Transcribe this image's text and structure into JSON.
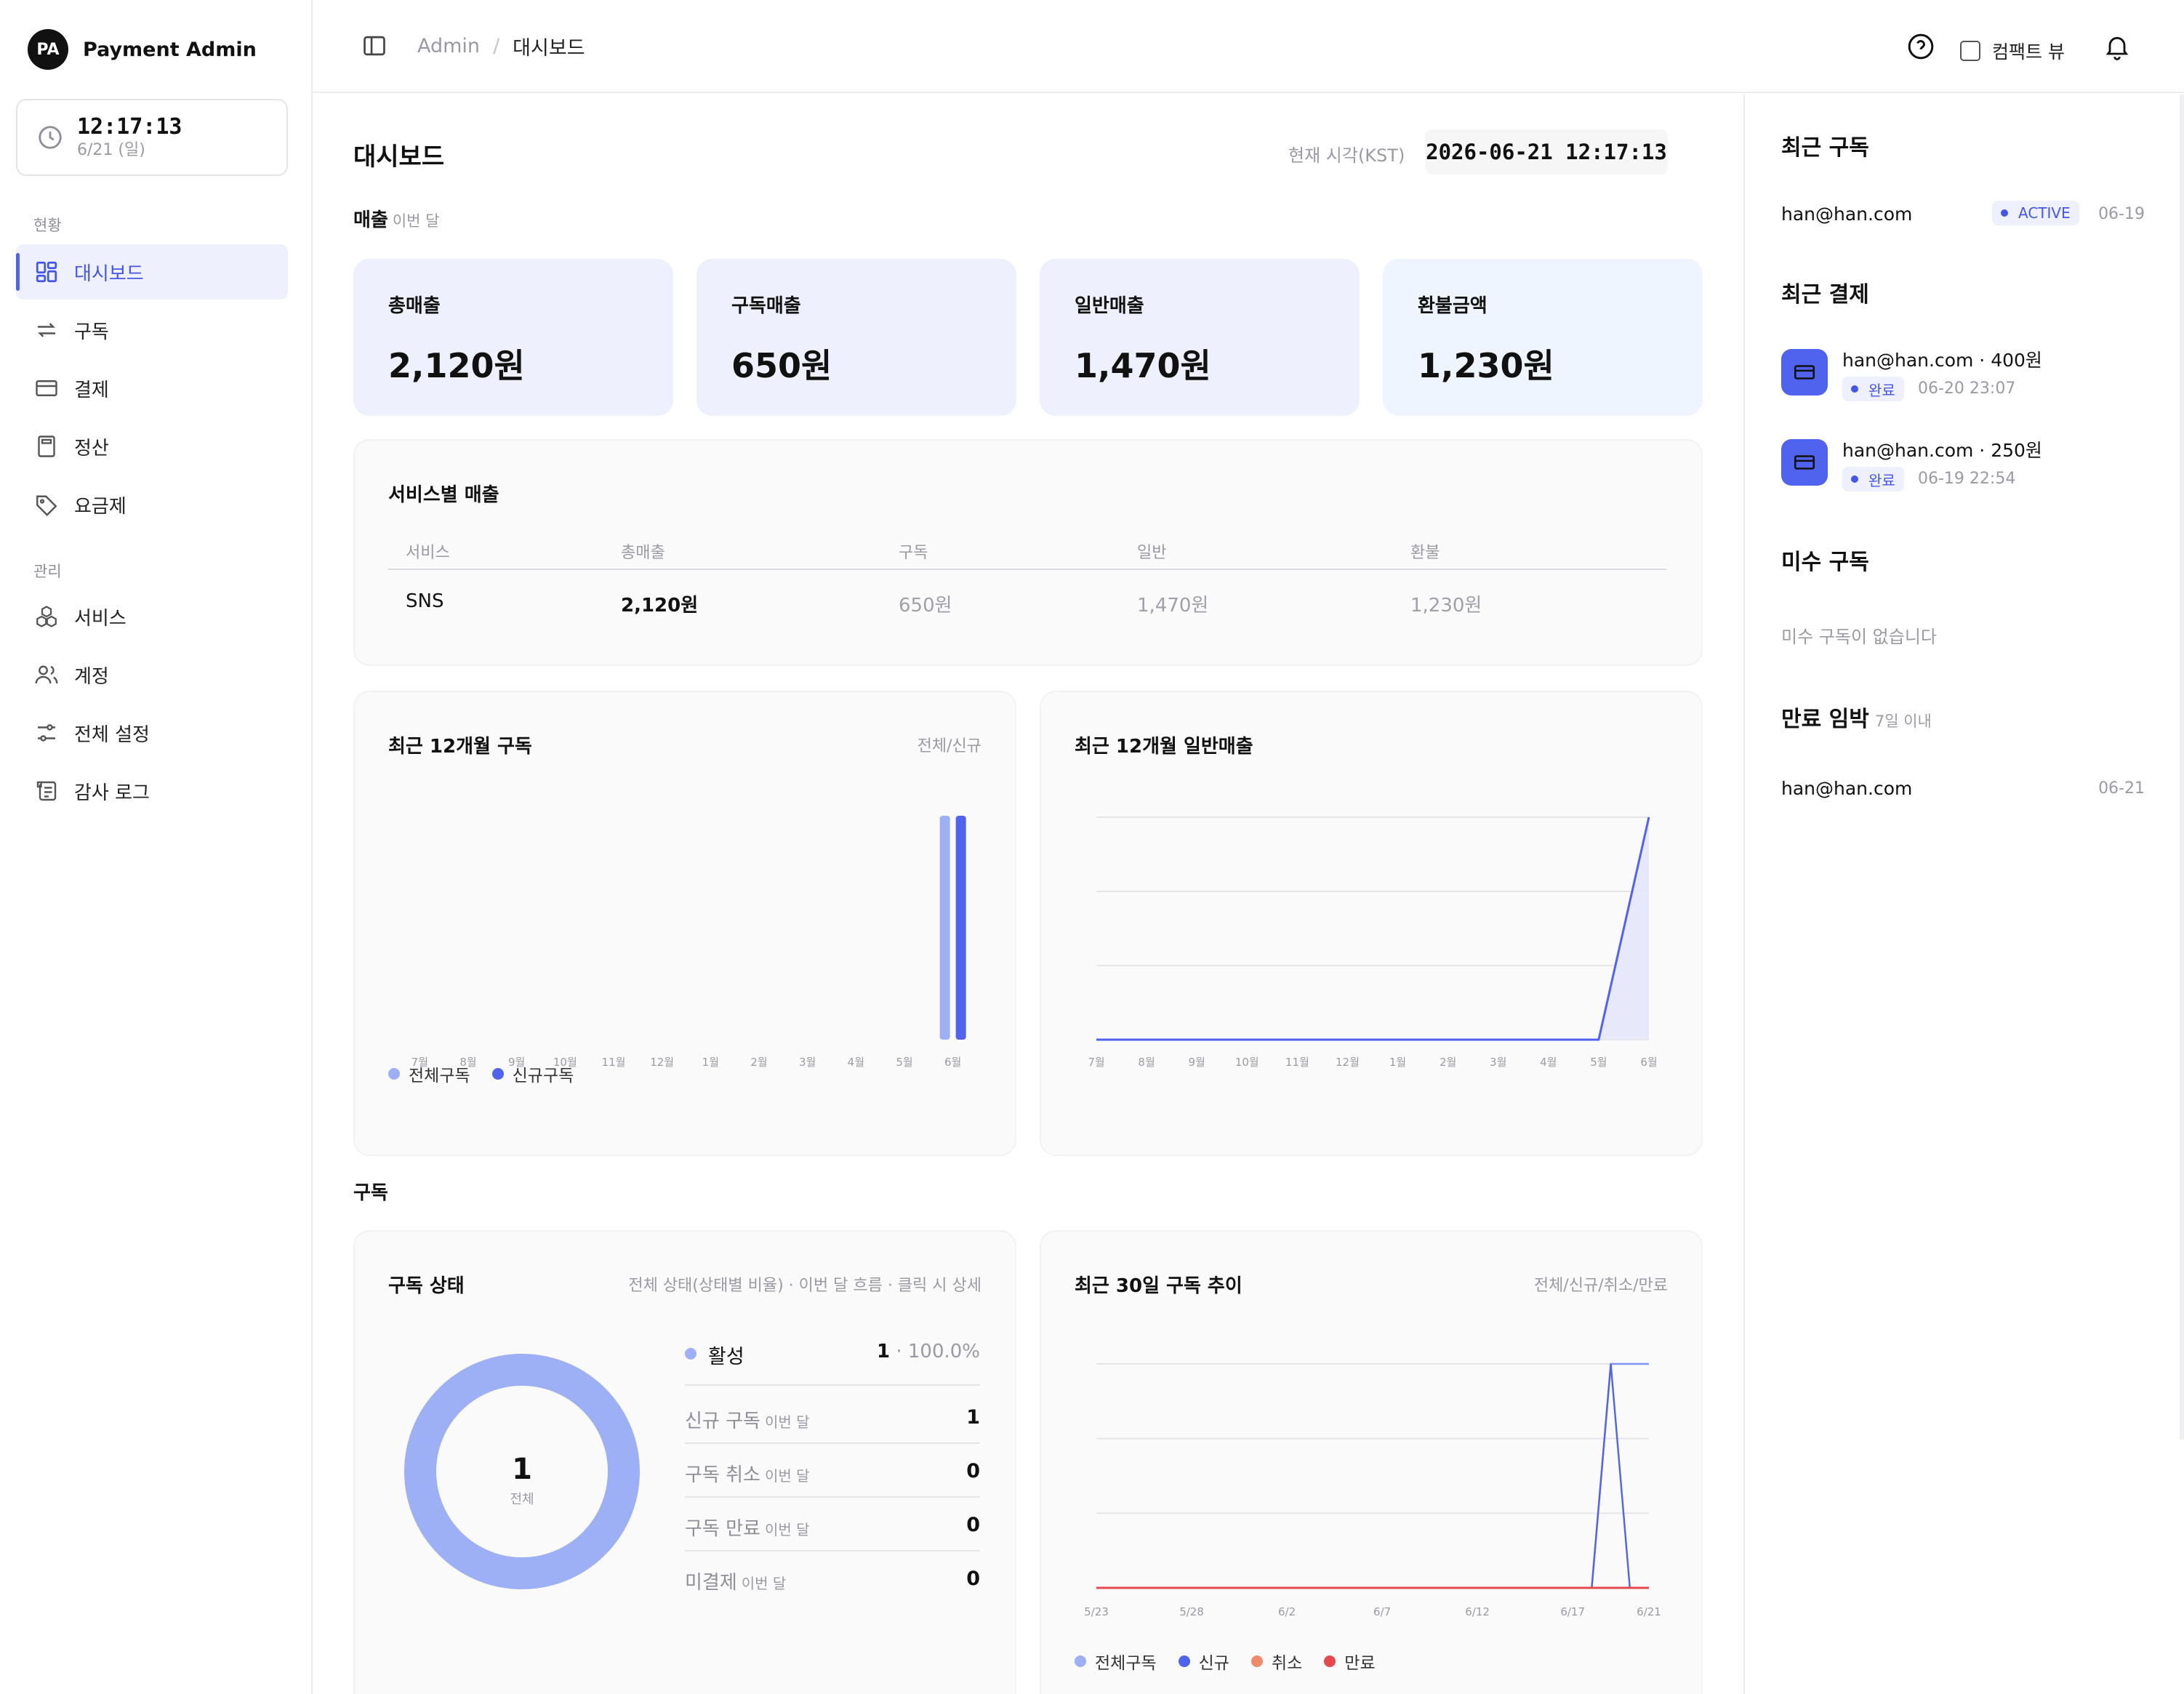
{
  "brand": {
    "logo": "PA",
    "name": "Payment Admin"
  },
  "clock": {
    "time": "12:17:13",
    "date": "6/21 (일)"
  },
  "nav": {
    "section_status": "현황",
    "section_manage": "관리",
    "items": [
      {
        "label": "대시보드",
        "icon": "dashboard-icon",
        "active": true
      },
      {
        "label": "구독",
        "icon": "repeat-icon"
      },
      {
        "label": "결제",
        "icon": "credit-card-icon"
      },
      {
        "label": "정산",
        "icon": "calculator-icon"
      },
      {
        "label": "요금제",
        "icon": "tag-icon"
      },
      {
        "label": "서비스",
        "icon": "boxes-icon"
      },
      {
        "label": "계정",
        "icon": "users-icon"
      },
      {
        "label": "전체 설정",
        "icon": "sliders-icon"
      },
      {
        "label": "감사 로그",
        "icon": "scroll-icon"
      }
    ]
  },
  "topbar": {
    "breadcrumb_root": "Admin",
    "breadcrumb_sep": "/",
    "breadcrumb_current": "대시보드",
    "compact_label": "컴팩트 뷰"
  },
  "page": {
    "title": "대시보드",
    "now_label": "현재 시각(KST)",
    "now_value": "2026-06-21 12:17:13"
  },
  "revenue": {
    "label": "매출",
    "sub": "이번 달",
    "kpis": [
      {
        "label": "총매출",
        "value": "2,120원"
      },
      {
        "label": "구독매출",
        "value": "650원"
      },
      {
        "label": "일반매출",
        "value": "1,470원"
      },
      {
        "label": "환불금액",
        "value": "1,230원"
      }
    ]
  },
  "service_table": {
    "title": "서비스별 매출",
    "headers": [
      "서비스",
      "총매출",
      "구독",
      "일반",
      "환불"
    ],
    "rows": [
      [
        "SNS",
        "2,120원",
        "650원",
        "1,470원",
        "1,230원"
      ]
    ]
  },
  "sub_chart_card": {
    "title": "최근 12개월 구독",
    "hint": "전체/신규",
    "legend": [
      "전체구독",
      "신규구독"
    ]
  },
  "rev_chart_card": {
    "title": "최근 12개월 일반매출"
  },
  "subscription_section": {
    "label": "구독"
  },
  "status_card": {
    "title": "구독 상태",
    "hint": "전체 상태(상태별 비율) · 이번 달 흐름 · 클릭 시 상세",
    "center_value": "1",
    "center_label": "전체",
    "active_label": "활성",
    "active_count": "1",
    "active_pct": " · 100.0%",
    "rows": [
      {
        "label": "신규 구독",
        "sub": "이번 달",
        "value": "1"
      },
      {
        "label": "구독 취소",
        "sub": "이번 달",
        "value": "0"
      },
      {
        "label": "구독 만료",
        "sub": "이번 달",
        "value": "0"
      },
      {
        "label": "미결제",
        "sub": "이번 달",
        "value": "0"
      }
    ]
  },
  "trend_card": {
    "title": "최근 30일 구독 추이",
    "hint": "전체/신규/취소/만료",
    "legend": [
      "전체구독",
      "신규",
      "취소",
      "만료"
    ]
  },
  "right": {
    "recent_subs_title": "최근 구독",
    "recent_subs": [
      {
        "email": "han@han.com",
        "status": "ACTIVE",
        "date": "06-19"
      }
    ],
    "recent_pay_title": "최근 결제",
    "recent_pays": [
      {
        "line": "han@han.com · 400원",
        "status": "완료",
        "datetime": "06-20 23:07"
      },
      {
        "line": "han@han.com · 250원",
        "status": "완료",
        "datetime": "06-19 22:54"
      }
    ],
    "unpaid_title": "미수 구독",
    "unpaid_empty": "미수 구독이 없습니다",
    "expiring_title": "만료 임박",
    "expiring_sub": "7일 이내",
    "expiring": [
      {
        "email": "han@han.com",
        "date": "06-21"
      }
    ]
  },
  "colors": {
    "accent": "#4f63ee",
    "accent_light": "#9db0f5",
    "cancel": "#f08a6a",
    "expire": "#e5484d"
  },
  "chart_data": [
    {
      "type": "bar",
      "title": "최근 12개월 구독",
      "categories": [
        "7월",
        "8월",
        "9월",
        "10월",
        "11월",
        "12월",
        "1월",
        "2월",
        "3월",
        "4월",
        "5월",
        "6월"
      ],
      "series": [
        {
          "name": "전체구독",
          "values": [
            0,
            0,
            0,
            0,
            0,
            0,
            0,
            0,
            0,
            0,
            0,
            1
          ]
        },
        {
          "name": "신규구독",
          "values": [
            0,
            0,
            0,
            0,
            0,
            0,
            0,
            0,
            0,
            0,
            0,
            1
          ]
        }
      ],
      "ylim": [
        0,
        1
      ]
    },
    {
      "type": "area",
      "title": "최근 12개월 일반매출",
      "categories": [
        "7월",
        "8월",
        "9월",
        "10월",
        "11월",
        "12월",
        "1월",
        "2월",
        "3월",
        "4월",
        "5월",
        "6월"
      ],
      "values": [
        0,
        0,
        0,
        0,
        0,
        0,
        0,
        0,
        0,
        0,
        0,
        1470
      ],
      "ylim": [
        0,
        1470
      ],
      "grid": true
    },
    {
      "type": "line",
      "title": "최근 30일 구독 추이",
      "x_ticks": [
        "5/23",
        "5/28",
        "6/2",
        "6/7",
        "6/12",
        "6/17",
        "6/21"
      ],
      "x_range": [
        "5/23",
        "6/21"
      ],
      "series": [
        {
          "name": "전체구독",
          "points": [
            [
              "5/23",
              0
            ],
            [
              "6/18",
              0
            ],
            [
              "6/19",
              1
            ],
            [
              "6/21",
              1
            ]
          ]
        },
        {
          "name": "신규",
          "points": [
            [
              "5/23",
              0
            ],
            [
              "6/18",
              0
            ],
            [
              "6/19",
              1
            ],
            [
              "6/20",
              0
            ],
            [
              "6/21",
              0
            ]
          ]
        },
        {
          "name": "취소",
          "points": [
            [
              "5/23",
              0
            ],
            [
              "6/21",
              0
            ]
          ]
        },
        {
          "name": "만료",
          "points": [
            [
              "5/23",
              0
            ],
            [
              "6/21",
              0
            ]
          ]
        }
      ],
      "ylim": [
        0,
        1
      ],
      "grid": true
    }
  ]
}
